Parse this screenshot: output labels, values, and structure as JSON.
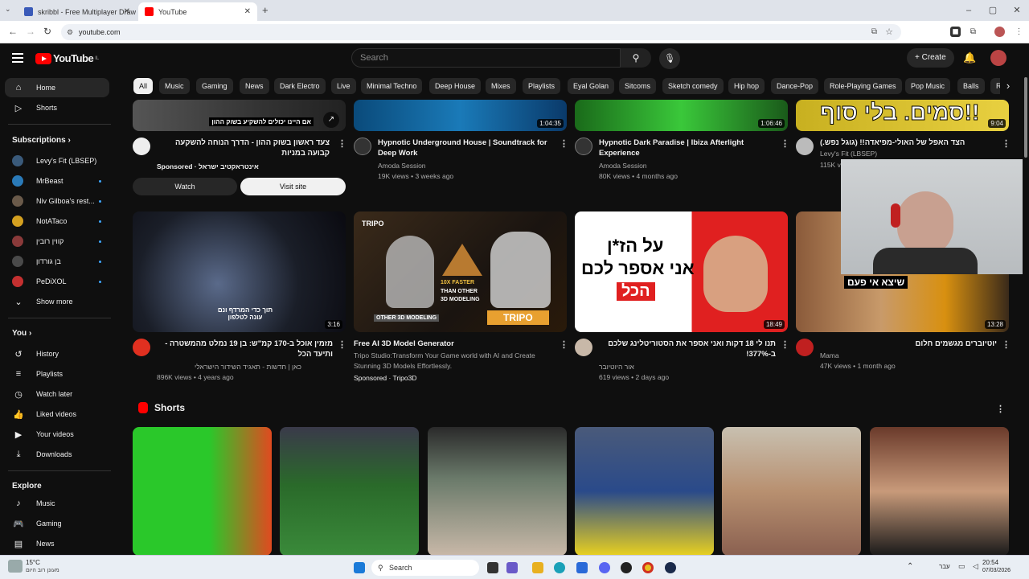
{
  "browser": {
    "tabs": [
      {
        "title": "skribbl - Free Multiplayer Draw"
      },
      {
        "title": "YouTube"
      }
    ],
    "url": "youtube.com"
  },
  "yt": {
    "logo": "YouTube",
    "region": "IL",
    "search_placeholder": "Search",
    "create_label": "Create"
  },
  "sidebar": {
    "main": [
      {
        "label": "Home",
        "icon": "home-icon"
      },
      {
        "label": "Shorts",
        "icon": "shorts-icon"
      }
    ],
    "subs_title": "Subscriptions",
    "subs": [
      {
        "label": "Levy's Fit (LBSEP)",
        "color": "#3a5a7a"
      },
      {
        "label": "MrBeast",
        "color": "#2a7ab8"
      },
      {
        "label": "Niv Gilboa's rest...",
        "color": "#6a5a4a"
      },
      {
        "label": "NotATaco",
        "color": "#d4a020"
      },
      {
        "label": "קווין רובין",
        "color": "#8a3a3a"
      },
      {
        "label": "בן גורדון",
        "color": "#4a4a4a"
      },
      {
        "label": "PeDiXOL",
        "color": "#c43030"
      }
    ],
    "show_more": "Show more",
    "you_title": "You",
    "you": [
      {
        "label": "History",
        "icon": "history-icon"
      },
      {
        "label": "Playlists",
        "icon": "playlists-icon"
      },
      {
        "label": "Watch later",
        "icon": "watch-later-icon"
      },
      {
        "label": "Liked videos",
        "icon": "liked-icon"
      },
      {
        "label": "Your videos",
        "icon": "your-videos-icon"
      },
      {
        "label": "Downloads",
        "icon": "downloads-icon"
      }
    ],
    "explore_title": "Explore",
    "explore": [
      {
        "label": "Music",
        "icon": "music-icon"
      },
      {
        "label": "Gaming",
        "icon": "gaming-icon"
      },
      {
        "label": "News",
        "icon": "news-icon"
      }
    ]
  },
  "chips": [
    "All",
    "Music",
    "Gaming",
    "News",
    "Dark Electro",
    "Live",
    "Minimal Techno",
    "Deep House",
    "Mixes",
    "Playlists",
    "Eyal Golan",
    "Sitcoms",
    "Sketch comedy",
    "Hip hop",
    "Dance-Pop",
    "Role-Playing Games",
    "Pop Music",
    "Balls",
    "R"
  ],
  "row1": [
    {
      "title": "צעד ראשון בשוק ההון - הדרך הנוחה להשקעה קבועה במניות",
      "meta1": "Sponsored · אינטראקטיב ישראל",
      "overlay": "אם היינו יכולים להשקיע בשוק ההון",
      "watch": "Watch",
      "visit": "Visit site"
    },
    {
      "title": "Hypnotic Underground House | Soundtrack for Deep Work",
      "meta1": "Amoda Session",
      "meta2": "19K views • 3 weeks ago",
      "duration": "1:04:35"
    },
    {
      "title": "Hypnotic Dark Paradise | Ibiza Afterlight Experience",
      "meta1": "Amoda Session",
      "meta2": "80K views • 4 months ago",
      "duration": "1:06:46"
    },
    {
      "title": "הצד האפל של האולי-מפיאדה!! (גוגל נפש.)",
      "meta1": "Levy's Fit (LBSEP)",
      "meta2": "115K v",
      "duration": "9:04",
      "overlay": "סמים. בלי סוף!!"
    }
  ],
  "row2": [
    {
      "title": "מזמין אוכל ב-170 קמ\"ש: בן 19 נמלט מהמשטרה - ותיעד הכל",
      "meta1": "כאן | חדשות - תאגיד השידור הישראלי",
      "meta2": "896K views • 4 years ago",
      "duration": "3:16",
      "overlay": "תוך כדי המרדף ונם עונה לטלפון"
    },
    {
      "title": "Free AI 3D Model Generator",
      "meta1": "Tripo Studio:Transform Your Game world with AI and Create Stunning 3D Models Effortlessly.",
      "meta2": "Sponsored · Tripo3D",
      "brand": "TRIPO",
      "ov1": "10X FASTER",
      "ov2": "THAN OTHER",
      "ov3": "3D MODELING",
      "ov4": "OTHER 3D MODELING",
      "cta": "TRIPO"
    },
    {
      "title": "תנו לי 18 דקות ואני אספר את הסטוריטלינג שלכם ב-377%!",
      "meta1": "אור היוטיובר",
      "meta2": "619 views • 2 days ago",
      "duration": "18:49",
      "ov1": "על הז*ן",
      "ov2": "אני אספר לכם",
      "ov3": "הכל"
    },
    {
      "title": "יוטיוברים מגשמים חלום",
      "meta1": "Mama",
      "meta2": "47K views • 1 month ago",
      "duration": "13:28",
      "overlay": "שיצא אי פעם"
    }
  ],
  "shorts_title": "Shorts",
  "taskbar": {
    "temp": "15°C",
    "weather": "מעונן רוב היום",
    "search": "Search",
    "time": "20:54",
    "date": "07/03/2026",
    "lang": "עבר"
  }
}
